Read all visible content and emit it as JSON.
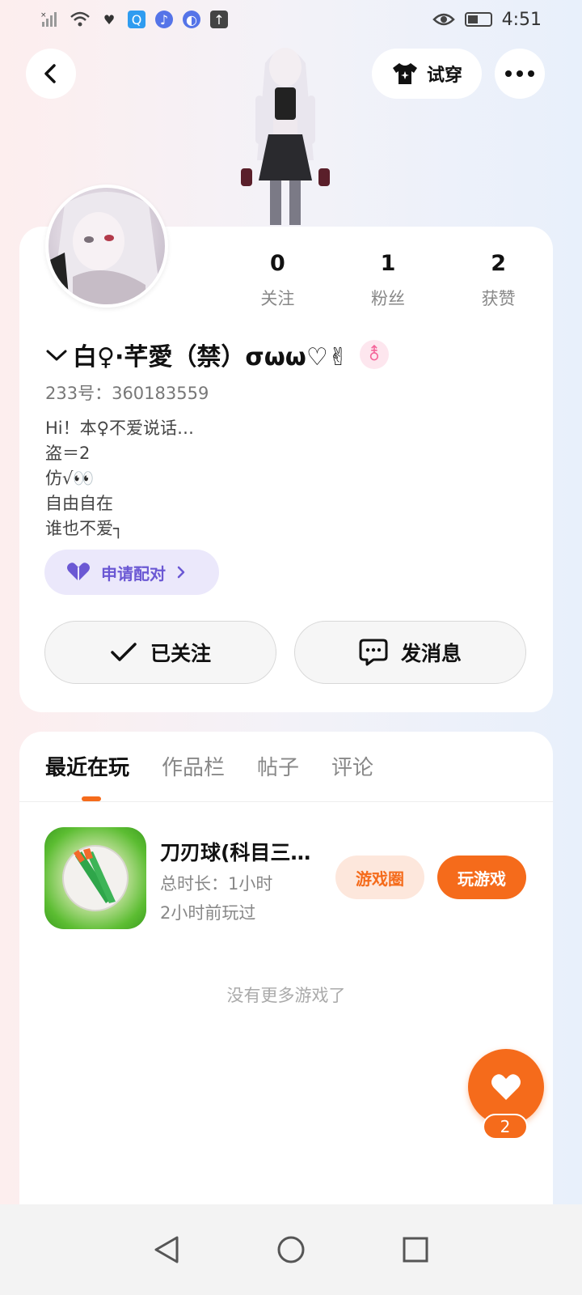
{
  "status_bar": {
    "time": "4:51"
  },
  "header": {
    "tryon_label": "试穿"
  },
  "profile": {
    "stats": [
      {
        "value": "0",
        "label": "关注"
      },
      {
        "value": "1",
        "label": "粉丝"
      },
      {
        "value": "2",
        "label": "获赞"
      }
    ],
    "name": "白♀·芊愛（禁）σωω♡✌",
    "gender_symbol": "⚨",
    "id_text": "233号：360183559",
    "bio": [
      "Hi！本♀不爱说话…",
      "盗＝2",
      "仿√👀",
      "自由自在",
      "谁也不爱┐"
    ],
    "pair_label": "申请配对",
    "follow_label": "已关注",
    "message_label": "发消息"
  },
  "tabs": [
    {
      "label": "最近在玩"
    },
    {
      "label": "作品栏"
    },
    {
      "label": "帖子"
    },
    {
      "label": "评论"
    }
  ],
  "game": {
    "title": "刀刃球(科目三…",
    "playtime": "总时长：1小时",
    "last_played": "2小时前玩过",
    "circle_label": "游戏圈",
    "play_label": "玩游戏"
  },
  "no_more_text": "没有更多游戏了",
  "likes": {
    "count": "2"
  },
  "colors": {
    "accent": "#f56b1b",
    "pair_purple": "#6b58d4"
  }
}
